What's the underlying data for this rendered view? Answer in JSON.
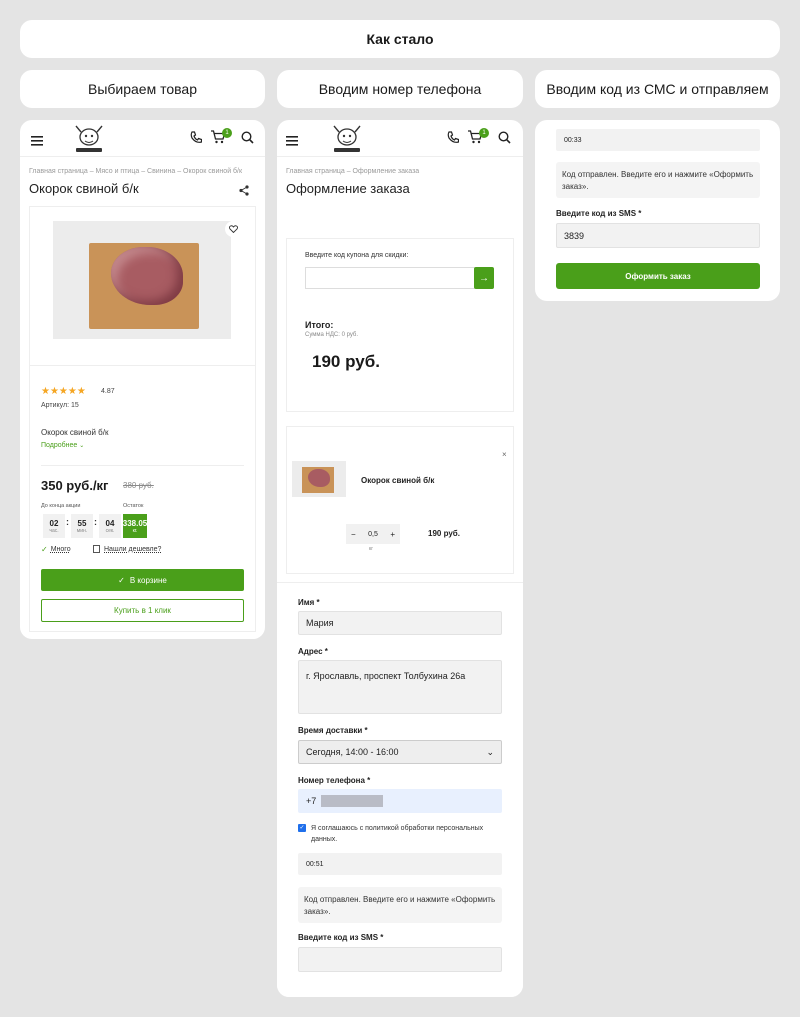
{
  "top_banner": "Как стало",
  "steps": [
    "Выбираем товар",
    "Вводим номер телефона",
    "Вводим код из СМС и отправляем"
  ],
  "header": {
    "cart_count": "1"
  },
  "product": {
    "breadcrumb": "Главная страница  –  Мясо и птица  –  Свинина  –  Окорок свиной б/к",
    "title": "Окорок свиной б/к",
    "rating_value": "4.87",
    "stars": "★★★★★",
    "article": "Артикул: 15",
    "name": "Окорок свиной б/к",
    "more": "Подробнее",
    "price": "350 руб./кг",
    "old_price": "380 руб.",
    "promo_label": "До конца акции",
    "stock_label": "Остаток",
    "timer_hours": "02",
    "timer_hours_unit": "час.",
    "timer_minutes": "55",
    "timer_minutes_unit": "мин.",
    "timer_seconds": "04",
    "timer_seconds_unit": "сек.",
    "stock_value": "338.05",
    "stock_unit": "кг.",
    "availability": "Много",
    "cheaper": "Нашли дешевле?",
    "in_cart": "В корзине",
    "one_click": "Купить в 1 клик"
  },
  "checkout": {
    "breadcrumb": "Главная страница  –  Оформление заказа",
    "title": "Оформление заказа",
    "coupon_label": "Введите код купона для скидки:",
    "total_label": "Итого:",
    "vat": "Сумма НДС: 0 руб.",
    "total_value": "190 руб.",
    "item_name": "Окорок свиной б/к",
    "qty": "0,5",
    "qty_unit": "кг",
    "item_price": "190 руб.",
    "name_label": "Имя *",
    "name_value": "Мария",
    "address_label": "Адрес *",
    "address_value": "г. Ярославль, проспект Толбухина 26а",
    "delivery_label": "Время доставки *",
    "delivery_value": "Сегодня, 14:00 - 16:00",
    "phone_label": "Номер телефона *",
    "phone_prefix": "+7",
    "consent": "Я соглашаюсь с политикой обработки персональных данных.",
    "timer": "00:51",
    "sent_note": "Код отправлен. Введите его и нажмите «Оформить заказ».",
    "sms_label": "Введите код из SMS *",
    "sms_value": ""
  },
  "sms_step": {
    "timer": "00:33",
    "sent_note": "Код отправлен. Введите его и нажмите «Оформить заказ».",
    "sms_label": "Введите код из SMS *",
    "sms_value": "3839",
    "submit": "Оформить заказ"
  }
}
